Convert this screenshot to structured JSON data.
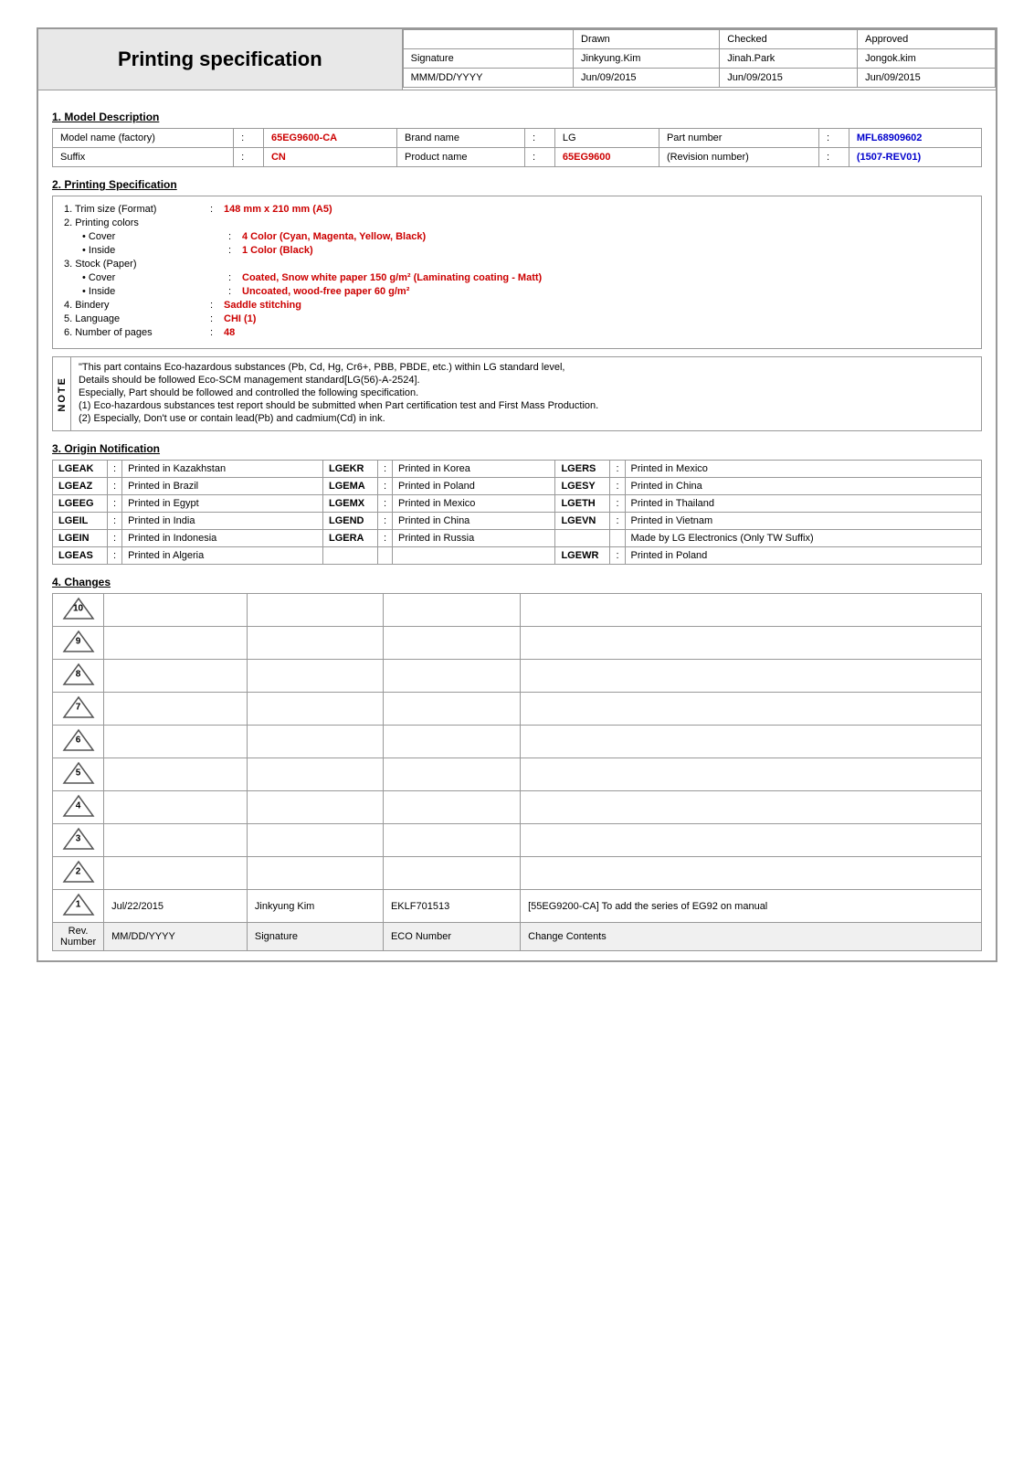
{
  "header": {
    "title": "Printing specification",
    "columns": [
      "",
      "Drawn",
      "Checked",
      "Approved"
    ],
    "rows": [
      {
        "label": "Signature",
        "drawn": "Jinkyung.Kim",
        "checked": "Jinah.Park",
        "approved": "Jongok.kim"
      },
      {
        "label": "MMM/DD/YYYY",
        "drawn": "Jun/09/2015",
        "checked": "Jun/09/2015",
        "approved": "Jun/09/2015"
      }
    ]
  },
  "sections": {
    "model_description": {
      "title": "1. Model Description",
      "rows": [
        {
          "fields": [
            {
              "label": "Model name (factory)",
              "colon": ":",
              "value": "65EG9600-CA",
              "value_style": "red"
            },
            {
              "label": "Brand name",
              "colon": ":",
              "value": "LG"
            },
            {
              "label": "Part number",
              "colon": ":",
              "value": "MFL68909602",
              "value_style": "blue"
            }
          ]
        },
        {
          "fields": [
            {
              "label": "Suffix",
              "colon": ":",
              "value": "CN",
              "value_style": "red"
            },
            {
              "label": "Product name",
              "colon": ":",
              "value": "65EG9600",
              "value_style": "red"
            },
            {
              "label": "(Revision number)",
              "colon": ":",
              "value": "(1507-REV01)",
              "value_style": "blue"
            }
          ]
        }
      ]
    },
    "printing_specification": {
      "title": "2. Printing Specification",
      "items": [
        {
          "number": "1.",
          "label": "Trim size (Format)",
          "colon": ":",
          "value": "148 mm x 210 mm (A5)"
        },
        {
          "number": "2.",
          "label": "Printing colors",
          "colon": "",
          "value": ""
        },
        {
          "number": "",
          "label": "• Cover",
          "colon": ":",
          "value": "4 Color (Cyan, Magenta, Yellow, Black)",
          "indent": true
        },
        {
          "number": "",
          "label": "• Inside",
          "colon": ":",
          "value": "1 Color (Black)",
          "indent": true
        },
        {
          "number": "3.",
          "label": "Stock (Paper)",
          "colon": "",
          "value": ""
        },
        {
          "number": "",
          "label": "• Cover",
          "colon": ":",
          "value": "Coated, Snow white paper 150 g/m²  (Laminating coating - Matt)",
          "indent": true
        },
        {
          "number": "",
          "label": "• Inside",
          "colon": ":",
          "value": "Uncoated, wood-free paper 60 g/m²",
          "indent": true
        },
        {
          "number": "4.",
          "label": "Bindery",
          "colon": ":",
          "value": "Saddle stitching"
        },
        {
          "number": "5.",
          "label": "Language",
          "colon": ":",
          "value": "CHI (1)"
        },
        {
          "number": "6.",
          "label": "Number of pages",
          "colon": ":",
          "value": "48"
        }
      ]
    },
    "notes": {
      "side_label": "NOTE",
      "items": [
        "\"This part contains Eco-hazardous substances (Pb, Cd, Hg, Cr6+, PBB, PBDE, etc.) within LG standard level,",
        "Details should be followed Eco-SCM management standard[LG(56)-A-2524].",
        "Especially, Part should be followed and controlled the following specification.",
        "(1) Eco-hazardous substances test report should be submitted when Part certification test and First Mass Production.",
        "(2) Especially, Don't use or contain lead(Pb) and cadmium(Cd) in ink."
      ]
    },
    "origin_notification": {
      "title": "3. Origin Notification",
      "columns": [
        [
          {
            "code": "LGEAK",
            "colon": ":",
            "value": "Printed in Kazakhstan"
          },
          {
            "code": "LGEAZ",
            "colon": ":",
            "value": "Printed in Brazil"
          },
          {
            "code": "LGEEG",
            "colon": ":",
            "value": "Printed in Egypt"
          },
          {
            "code": "LGEIL",
            "colon": ":",
            "value": "Printed in India"
          },
          {
            "code": "LGEIN",
            "colon": ":",
            "value": "Printed in Indonesia"
          },
          {
            "code": "LGEAS",
            "colon": ":",
            "value": "Printed in Algeria"
          }
        ],
        [
          {
            "code": "LGEKR",
            "colon": ":",
            "value": "Printed in Korea"
          },
          {
            "code": "LGEMA",
            "colon": ":",
            "value": "Printed in Poland"
          },
          {
            "code": "LGEMX",
            "colon": ":",
            "value": "Printed in Mexico"
          },
          {
            "code": "LGEND",
            "colon": ":",
            "value": "Printed in China"
          },
          {
            "code": "LGERA",
            "colon": ":",
            "value": "Printed in Russia"
          },
          {
            "code": "",
            "colon": "",
            "value": ""
          }
        ],
        [
          {
            "code": "LGERS",
            "colon": ":",
            "value": "Printed in Mexico"
          },
          {
            "code": "LGESY",
            "colon": ":",
            "value": "Printed in China"
          },
          {
            "code": "LGETH",
            "colon": ":",
            "value": "Printed in Thailand"
          },
          {
            "code": "LGEVN",
            "colon": ":",
            "value": "Printed in Vietnam"
          },
          {
            "code": "",
            "colon": "",
            "value": "Made by LG Electronics (Only TW Suffix)"
          },
          {
            "code": "LGEWR",
            "colon": ":",
            "value": "Printed in Poland"
          }
        ]
      ]
    },
    "changes": {
      "title": "4. Changes",
      "rows": [
        {
          "rev": "10",
          "date": "",
          "signature": "",
          "eco": "",
          "contents": ""
        },
        {
          "rev": "9",
          "date": "",
          "signature": "",
          "eco": "",
          "contents": ""
        },
        {
          "rev": "8",
          "date": "",
          "signature": "",
          "eco": "",
          "contents": ""
        },
        {
          "rev": "7",
          "date": "",
          "signature": "",
          "eco": "",
          "contents": ""
        },
        {
          "rev": "6",
          "date": "",
          "signature": "",
          "eco": "",
          "contents": ""
        },
        {
          "rev": "5",
          "date": "",
          "signature": "",
          "eco": "",
          "contents": ""
        },
        {
          "rev": "4",
          "date": "",
          "signature": "",
          "eco": "",
          "contents": ""
        },
        {
          "rev": "3",
          "date": "",
          "signature": "",
          "eco": "",
          "contents": ""
        },
        {
          "rev": "2",
          "date": "",
          "signature": "",
          "eco": "",
          "contents": ""
        },
        {
          "rev": "1",
          "date": "Jul/22/2015",
          "signature": "Jinkyung Kim",
          "eco": "EKLF701513",
          "contents": "[55EG9200-CA] To add the series of EG92 on manual"
        }
      ],
      "footer": {
        "rev_label": "Rev. Number",
        "date_label": "MM/DD/YYYY",
        "sig_label": "Signature",
        "eco_label": "ECO Number",
        "contents_label": "Change Contents"
      }
    }
  }
}
